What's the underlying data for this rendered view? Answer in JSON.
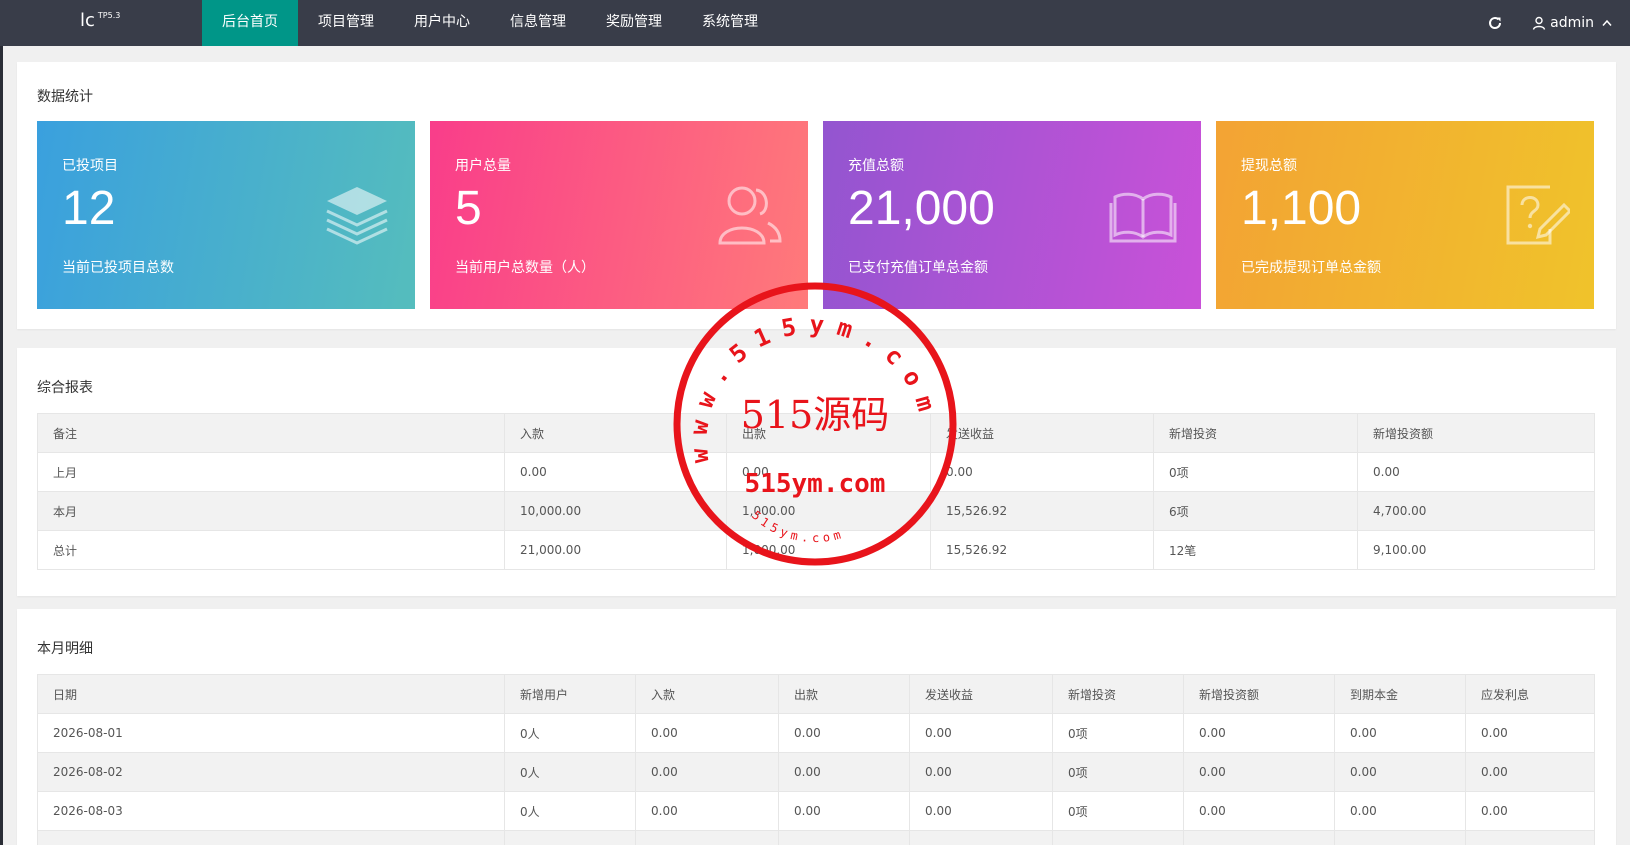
{
  "header": {
    "logo": "lc",
    "logo_sup": "TP5.3",
    "nav": [
      "后台首页",
      "项目管理",
      "用户中心",
      "信息管理",
      "奖励管理",
      "系统管理"
    ],
    "active_nav": 0,
    "user": "admin"
  },
  "stats_section": {
    "title": "数据统计",
    "cards": [
      {
        "label": "已投项目",
        "value": "12",
        "desc": "当前已投项目总数",
        "icon": "layers-icon"
      },
      {
        "label": "用户总量",
        "value": "5",
        "desc": "当前用户总数量（人）",
        "icon": "users-icon"
      },
      {
        "label": "充值总额",
        "value": "21,000",
        "desc": "已支付充值订单总金额",
        "icon": "book-icon"
      },
      {
        "label": "提现总额",
        "value": "1,100",
        "desc": "已完成提现订单总金额",
        "icon": "question-edit-icon"
      }
    ]
  },
  "report": {
    "title": "综合报表",
    "columns": [
      "备注",
      "入款",
      "出款",
      "发送收益",
      "新增投资",
      "新增投资额"
    ],
    "rows": [
      [
        "上月",
        "0.00",
        "0.00",
        "0.00",
        "0项",
        "0.00"
      ],
      [
        "本月",
        "10,000.00",
        "1,000.00",
        "15,526.92",
        "6项",
        "4,700.00"
      ],
      [
        "总计",
        "21,000.00",
        "1,000.00",
        "15,526.92",
        "12笔",
        "9,100.00"
      ]
    ]
  },
  "monthly": {
    "title": "本月明细",
    "columns": [
      "日期",
      "新增用户",
      "入款",
      "出款",
      "发送收益",
      "新增投资",
      "新增投资额",
      "到期本金",
      "应发利息"
    ],
    "rows": [
      [
        "2026-08-01",
        "0人",
        "0.00",
        "0.00",
        "0.00",
        "0项",
        "0.00",
        "0.00",
        "0.00"
      ],
      [
        "2026-08-02",
        "0人",
        "0.00",
        "0.00",
        "0.00",
        "0项",
        "0.00",
        "0.00",
        "0.00"
      ],
      [
        "2026-08-03",
        "0人",
        "0.00",
        "0.00",
        "0.00",
        "0项",
        "0.00",
        "0.00",
        "0.00"
      ],
      [
        "",
        "",
        "",
        "",
        "",
        "",
        "",
        "",
        ""
      ]
    ]
  },
  "watermark": {
    "ring_text": "www.515ym.com",
    "title": "515源码",
    "url": "515ym.com",
    "small": "515ym.com",
    "color": "#e8141b"
  },
  "colors": {
    "topbar": "#393d49",
    "active_nav": "#009688"
  }
}
